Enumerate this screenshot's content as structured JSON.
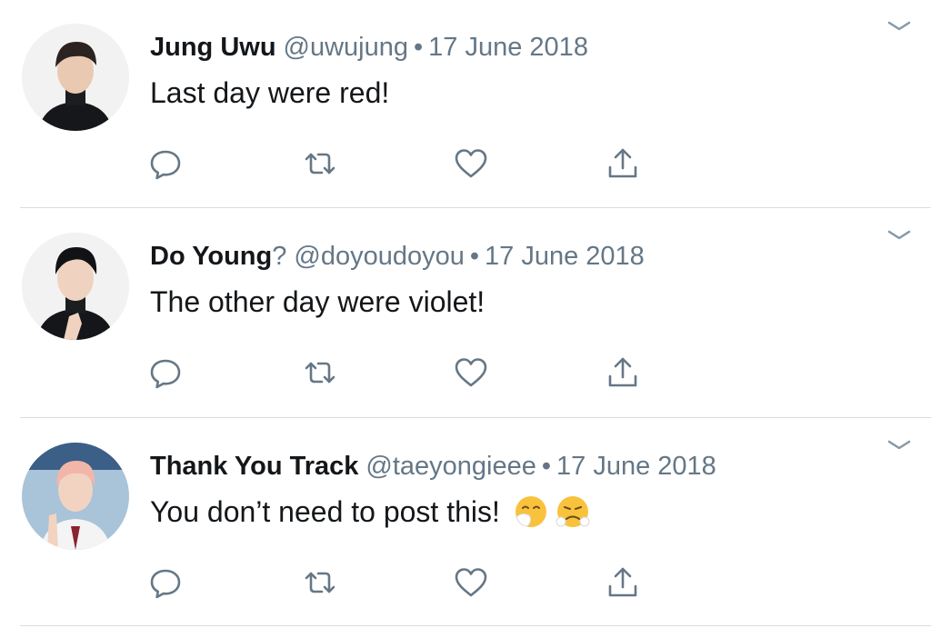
{
  "colors": {
    "text_primary": "#14171a",
    "text_secondary": "#657786",
    "icon": "#657786",
    "divider": "#d9dde1"
  },
  "tweets": [
    {
      "display_name": "Jung Uwu",
      "name_suffix": "",
      "handle": "@uwujung",
      "separator": "•",
      "date": "17 June 2018",
      "text": "Last day were red!",
      "emojis": []
    },
    {
      "display_name": "Do Young",
      "name_suffix": "?",
      "handle": "@doyoudoyou",
      "separator": "•",
      "date": "17 June 2018",
      "text": "The other day were violet!",
      "emojis": []
    },
    {
      "display_name": "Thank You Track",
      "name_suffix": "",
      "handle": "@taeyongieee",
      "separator": "•",
      "date": "17 June 2018",
      "text": "You don’t need to post this!",
      "emojis": [
        "sneezing-face-emoji",
        "face-with-steam-emoji"
      ]
    }
  ],
  "actions": [
    "reply-icon",
    "retweet-icon",
    "like-icon",
    "share-icon"
  ]
}
